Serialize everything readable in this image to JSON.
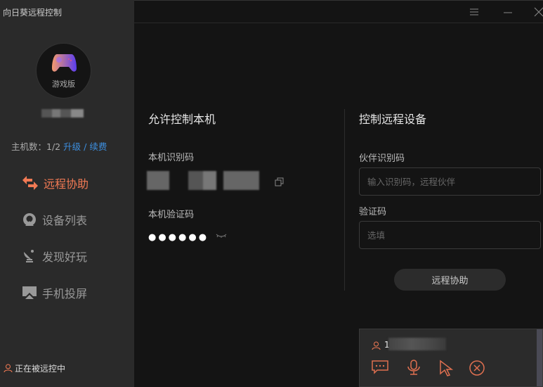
{
  "app": {
    "title": "向日葵远程控制"
  },
  "sidebar": {
    "edition": "游戏版",
    "host_count_label": "主机数：1/2",
    "upgrade": "升级",
    "sep": "/",
    "renew": "续费",
    "items": [
      {
        "label": "远程协助",
        "icon": "swap-arrows-icon",
        "active": true
      },
      {
        "label": "设备列表",
        "icon": "device-list-icon"
      },
      {
        "label": "发现好玩",
        "icon": "satellite-dish-icon"
      },
      {
        "label": "手机投屏",
        "icon": "screen-cast-icon"
      }
    ],
    "status": "正在被远控中"
  },
  "local": {
    "title": "允许控制本机",
    "id_label": "本机识别码",
    "code_label": "本机验证码",
    "code_masked": "●●●●●●"
  },
  "remote": {
    "title": "控制远程设备",
    "partner_label": "伙伴识别码",
    "partner_placeholder": "输入识别码，远程伙伴",
    "code_label": "验证码",
    "code_placeholder": "选填",
    "button": "远程协助"
  },
  "session": {
    "user_prefix": "1"
  },
  "colors": {
    "accent": "#f27a54",
    "link": "#3d8fe0"
  }
}
